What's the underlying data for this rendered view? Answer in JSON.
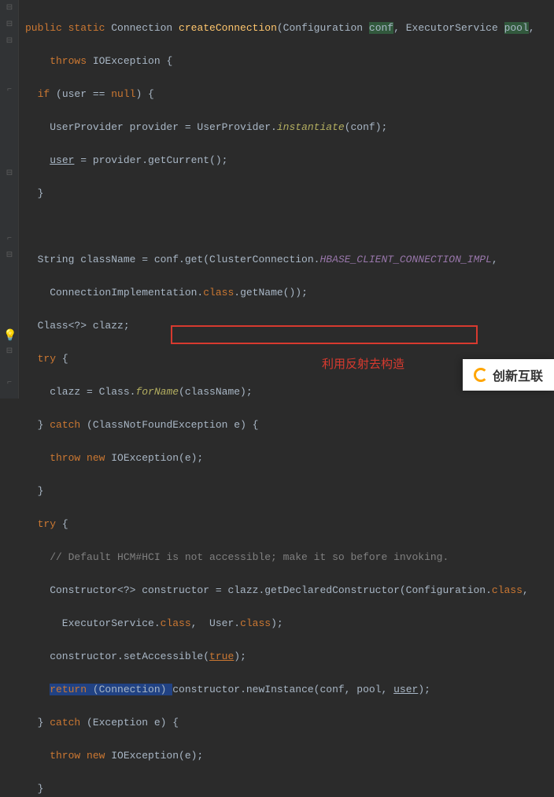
{
  "code": {
    "l1_a": "public static ",
    "l1_b": "Connection ",
    "l1_c": "createConnection",
    "l1_d": "(Configuration ",
    "l1_e": "conf",
    "l1_f": ", ExecutorService ",
    "l1_g": "pool",
    "l1_h": ",",
    "l2_a": "    throws ",
    "l2_b": "IOException {",
    "l3_a": "  if ",
    "l3_b": "(user == ",
    "l3_c": "null",
    "l3_d": ") {",
    "l4_a": "    UserProvider provider = UserProvider.",
    "l4_b": "instantiate",
    "l4_c": "(conf);",
    "l5_a": "    ",
    "l5_b": "user",
    "l5_c": " = provider.getCurrent();",
    "l6": "  }",
    "l7": "",
    "l8_a": "  String className = conf.get(ClusterConnection.",
    "l8_b": "HBASE_CLIENT_CONNECTION_IMPL",
    "l8_c": ",",
    "l9_a": "    ConnectionImplementation.",
    "l9_b": "class",
    "l9_c": ".getName());",
    "l10": "  Class<?> clazz;",
    "l11_a": "  try ",
    "l11_b": "{",
    "l12_a": "    clazz = Class.",
    "l12_b": "forName",
    "l12_c": "(className);",
    "l13_a": "  } ",
    "l13_b": "catch ",
    "l13_c": "(ClassNotFoundException e) {",
    "l14_a": "    throw new ",
    "l14_b": "IOException(e);",
    "l15": "  }",
    "l16_a": "  try ",
    "l16_b": "{",
    "l17": "    // Default HCM#HCI is not accessible; make it so before invoking.",
    "l18_a": "    Constructor<?> constructor = clazz.getDeclaredConstructor(Configuration.",
    "l18_b": "class",
    "l18_c": ",",
    "l19_a": "      ExecutorService.",
    "l19_b": "class",
    "l19_c": ",  User.",
    "l19_d": "class",
    "l19_e": ");",
    "l20_a": "    constructor.setAccessible(",
    "l20_b": "true",
    "l20_c": ");",
    "l21_a": "    ",
    "l21_b": "return ",
    "l21_c": "(Connection) ",
    "l21_d": "constructor.newInstance(conf, pool, ",
    "l21_e": "user",
    "l21_f": ");",
    "l22_a": "  } ",
    "l22_b": "catch ",
    "l22_c": "(Exception e) {",
    "l23_a": "    throw new ",
    "l23_b": "IOException(e);",
    "l24": "  }"
  },
  "annotation_text": "利用反射去构造",
  "watermark_text": "创新互联"
}
